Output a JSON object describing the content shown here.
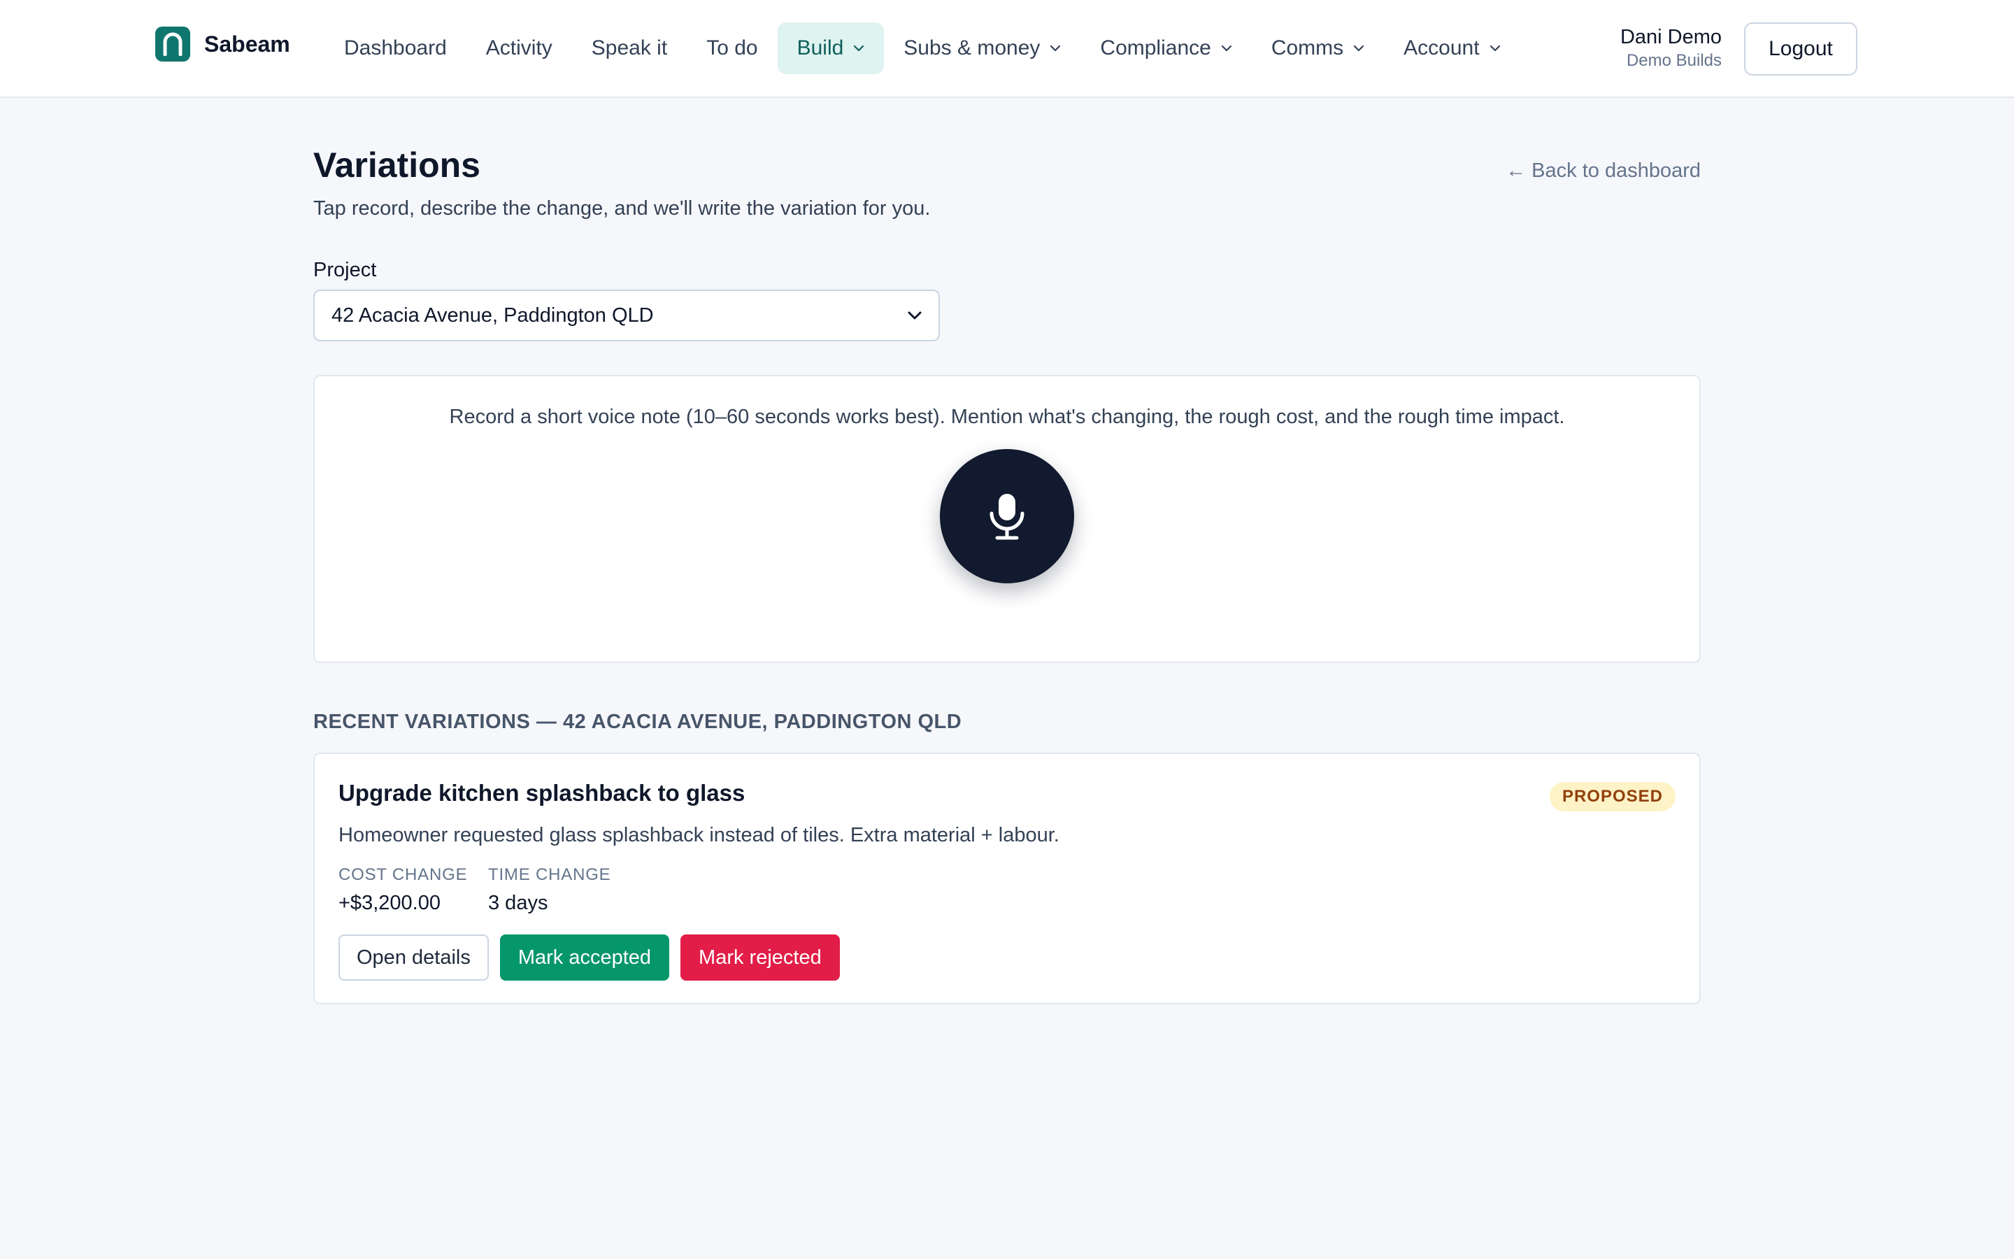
{
  "app": {
    "name": "Sabeam",
    "logo_icon": "arch-logo-icon"
  },
  "nav": {
    "items": [
      {
        "label": "Dashboard",
        "dropdown": false,
        "active": false
      },
      {
        "label": "Activity",
        "dropdown": false,
        "active": false
      },
      {
        "label": "Speak it",
        "dropdown": false,
        "active": false
      },
      {
        "label": "To do",
        "dropdown": false,
        "active": false
      },
      {
        "label": "Build",
        "dropdown": true,
        "active": true
      },
      {
        "label": "Subs & money",
        "dropdown": true,
        "active": false
      },
      {
        "label": "Compliance",
        "dropdown": true,
        "active": false
      },
      {
        "label": "Comms",
        "dropdown": true,
        "active": false
      },
      {
        "label": "Account",
        "dropdown": true,
        "active": false
      }
    ]
  },
  "user": {
    "name": "Dani Demo",
    "org": "Demo Builds",
    "logout_label": "Logout"
  },
  "page": {
    "title": "Variations",
    "subtitle": "Tap record, describe the change, and we'll write the variation for you.",
    "back_link": "← Back to dashboard"
  },
  "project": {
    "label": "Project",
    "selected": "42 Acacia Avenue, Paddington QLD"
  },
  "recorder": {
    "hint": "Record a short voice note (10–60 seconds works best). Mention what's changing, the rough cost, and the rough time impact.",
    "icon": "microphone-icon"
  },
  "recent": {
    "heading": "RECENT VARIATIONS — 42 ACACIA AVENUE, PADDINGTON QLD",
    "items": [
      {
        "title": "Upgrade kitchen splashback to glass",
        "status": "PROPOSED",
        "description": "Homeowner requested glass splashback instead of tiles. Extra material + labour.",
        "cost_label": "COST CHANGE",
        "cost_value": "+$3,200.00",
        "time_label": "TIME CHANGE",
        "time_value": "3 days",
        "open_label": "Open details",
        "accept_label": "Mark accepted",
        "reject_label": "Mark rejected"
      }
    ]
  },
  "colors": {
    "brand": "#0f766e",
    "active_nav_bg": "#dff3f1",
    "mic_button": "#111a2e",
    "accept": "#059669",
    "reject": "#e11d48",
    "badge_bg": "#fef3c7",
    "badge_text": "#92400e"
  }
}
